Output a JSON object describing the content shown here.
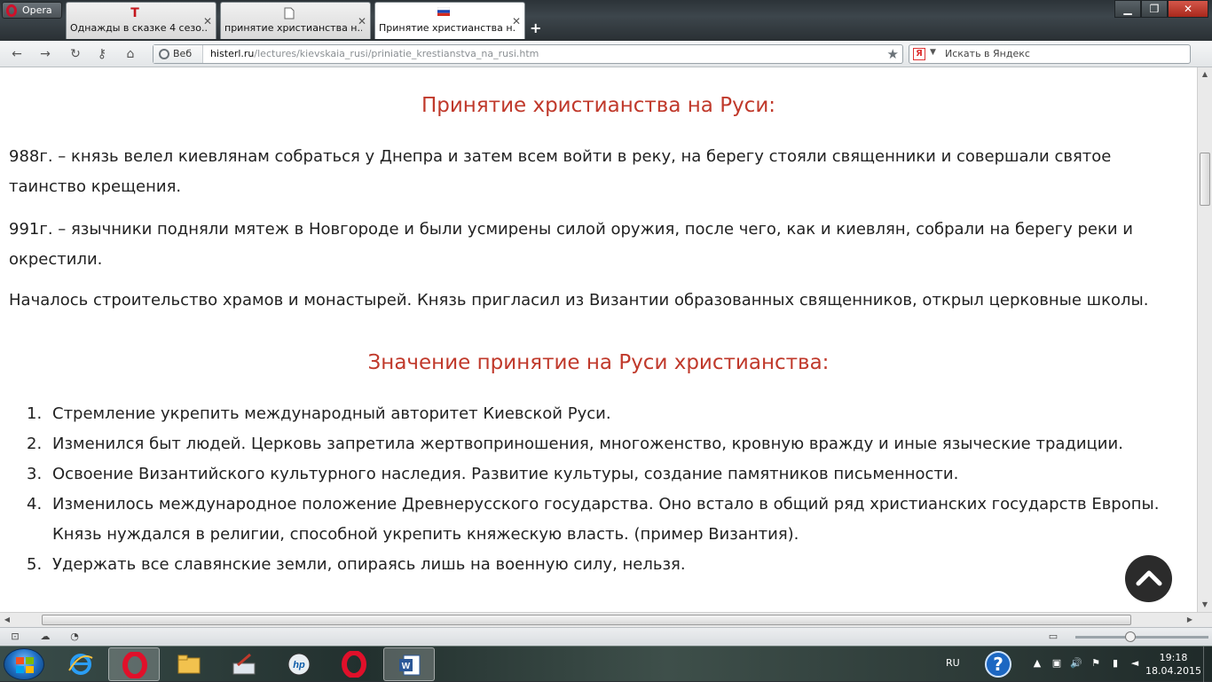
{
  "browser": {
    "menu_label": "Opera",
    "tabs": [
      {
        "title": "Однажды в сказке 4 сезо...",
        "icon": "T"
      },
      {
        "title": "принятие христианства н...",
        "icon": "document-icon"
      },
      {
        "title": "Принятие христианства н...",
        "icon": "russian-flag-icon"
      }
    ],
    "new_tab": "+",
    "window": {
      "minimize": "▁",
      "maximize": "❐",
      "close": "✕"
    },
    "address": {
      "badge": "Веб",
      "host": "histerl.ru",
      "path": "/lectures/kievskaia_rusi/priniatie_krestianstva_na_rusi.htm"
    },
    "search": {
      "engine": "Я",
      "placeholder": "Искать в Яндекс"
    }
  },
  "page": {
    "heading1": "Принятие христианства на Руси:",
    "paragraphs": [
      "988г. – князь велел киевлянам собраться у Днепра и затем всем войти в реку, на берегу стояли священники и совершали святое таинство крещения.",
      "991г. – язычники подняли мятеж в Новгороде и были усмирены силой оружия, после чего, как и киевлян, собрали на берегу реки и окрестили.",
      "Началось строительство храмов и монастырей. Князь пригласил из Византии образованных священников, открыл церковные школы."
    ],
    "heading2": "Значение принятие на Руси христианства:",
    "list": [
      {
        "num": "1.",
        "text": "Стремление укрепить международный авторитет Киевской Руси."
      },
      {
        "num": "2.",
        "text": "Изменился быт людей. Церковь запретила жертвоприношения, многоженство, кровную вражду и иные языческие традиции."
      },
      {
        "num": "3.",
        "text": "Освоение Византийского культурного наследия. Развитие культуры, создание памятников письменности."
      },
      {
        "num": "4.",
        "text": "Изменилось международное положение Древнерусского государства. Оно встало в общий ряд христианских государств Европы. Князь нуждался в религии, способной укрепить княжескую власть. (пример Византия)."
      },
      {
        "num": "5.",
        "text": "Удержать все славянские земли, опираясь лишь на военную силу, нельзя."
      }
    ]
  },
  "taskbar": {
    "lang": "RU",
    "help": "?",
    "time": "19:18",
    "date": "18.04.2015",
    "apps": [
      "internet-explorer-icon",
      "opera-icon",
      "file-explorer-icon",
      "paint-icon",
      "hp-icon",
      "opera-icon",
      "word-icon"
    ]
  },
  "colors": {
    "heading": "#c0392b",
    "text": "#222222",
    "accent_red": "#d0102a"
  }
}
